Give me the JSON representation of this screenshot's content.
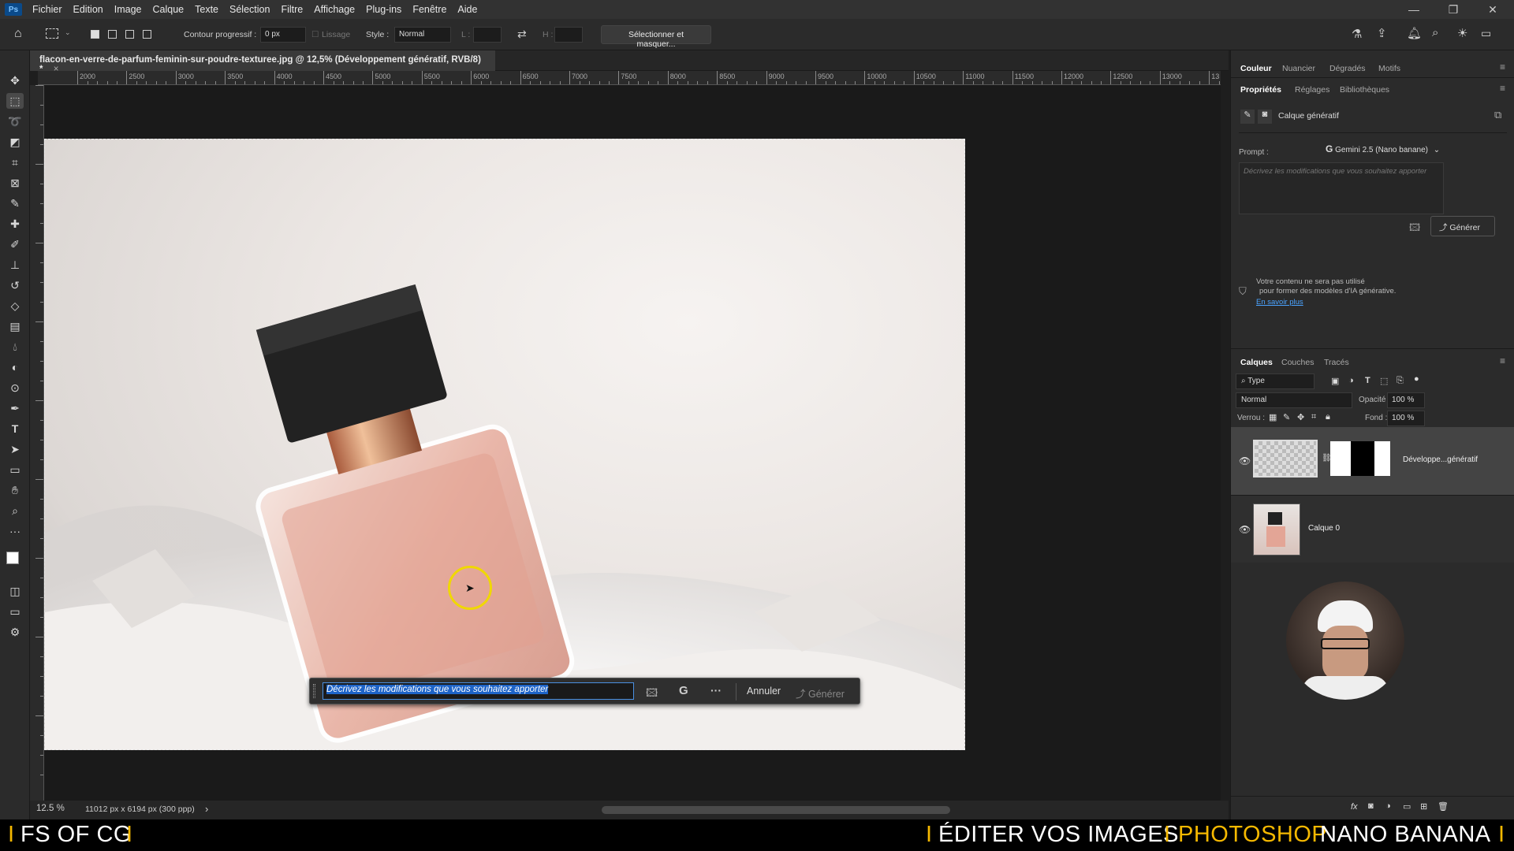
{
  "menubar": {
    "logo": "Ps",
    "items": [
      "Fichier",
      "Edition",
      "Image",
      "Calque",
      "Texte",
      "Sélection",
      "Filtre",
      "Affichage",
      "Plug-ins",
      "Fenêtre",
      "Aide"
    ]
  },
  "options": {
    "contour_label": "Contour progressif :",
    "contour_value": "0 px",
    "lissage": "Lissage",
    "style_label": "Style :",
    "style_value": "Normal",
    "l_label": "L :",
    "h_label": "H :",
    "select_mask": "Sélectionner et masquer..."
  },
  "document": {
    "tab_title": "flacon-en-verre-de-parfum-feminin-sur-poudre-texturee.jpg @ 12,5% (Développement génératif, RVB/8) *",
    "close": "×",
    "ruler_labels": [
      "2000",
      "2500",
      "3000",
      "3500",
      "4000",
      "4500",
      "5000",
      "5500",
      "6000",
      "6500",
      "7000",
      "7500",
      "8000",
      "8500",
      "9000",
      "9500",
      "10000",
      "10500",
      "11000",
      "11500",
      "12000",
      "12500",
      "13000",
      "13"
    ]
  },
  "status": {
    "zoom": "12.5 %",
    "info": "11012 px x 6194 px (300 ppp)",
    "arrow": "›"
  },
  "floating_bar": {
    "prompt_text": "Décrivez les modifications que vous souhaitez apporter",
    "google": "G",
    "more": "···",
    "cancel": "Annuler",
    "generate": "Générer"
  },
  "right_panel": {
    "top_tabs": [
      "Couleur",
      "Nuancier",
      "Dégradés",
      "Motifs"
    ],
    "prop_tabs": [
      "Propriétés",
      "Réglages",
      "Bibliothèques"
    ],
    "layer_type": "Calque génératif",
    "prompt_label": "Prompt :",
    "model": "Gemini 2.5 (Nano banane)",
    "prompt_placeholder": "Décrivez les modifications que vous souhaitez apporter",
    "generate": "Générer",
    "notice_line1": "Votre contenu ne sera pas utilisé",
    "notice_line2": "pour former des modèles d'IA générative.",
    "learn_more": "En savoir plus",
    "layers_tabs": [
      "Calques",
      "Couches",
      "Tracés"
    ],
    "filter_type": "Type",
    "blend_mode": "Normal",
    "opacity_label": "Opacité :",
    "opacity_value": "100 %",
    "lock_label": "Verrou :",
    "fill_label": "Fond :",
    "fill_value": "100 %",
    "layers": [
      {
        "name": "Développe...génératif"
      },
      {
        "name": "Calque 0"
      }
    ]
  },
  "banner": {
    "left": "FS OF CG",
    "edit": "ÉDITER VOS IMAGES",
    "photoshop": "PHOTOSHOP",
    "nano": "NANO BANANA",
    "sep": "I"
  },
  "colors": {
    "accent": "#f5b800",
    "selection": "#1e64c8",
    "link": "#4aa3ff"
  }
}
